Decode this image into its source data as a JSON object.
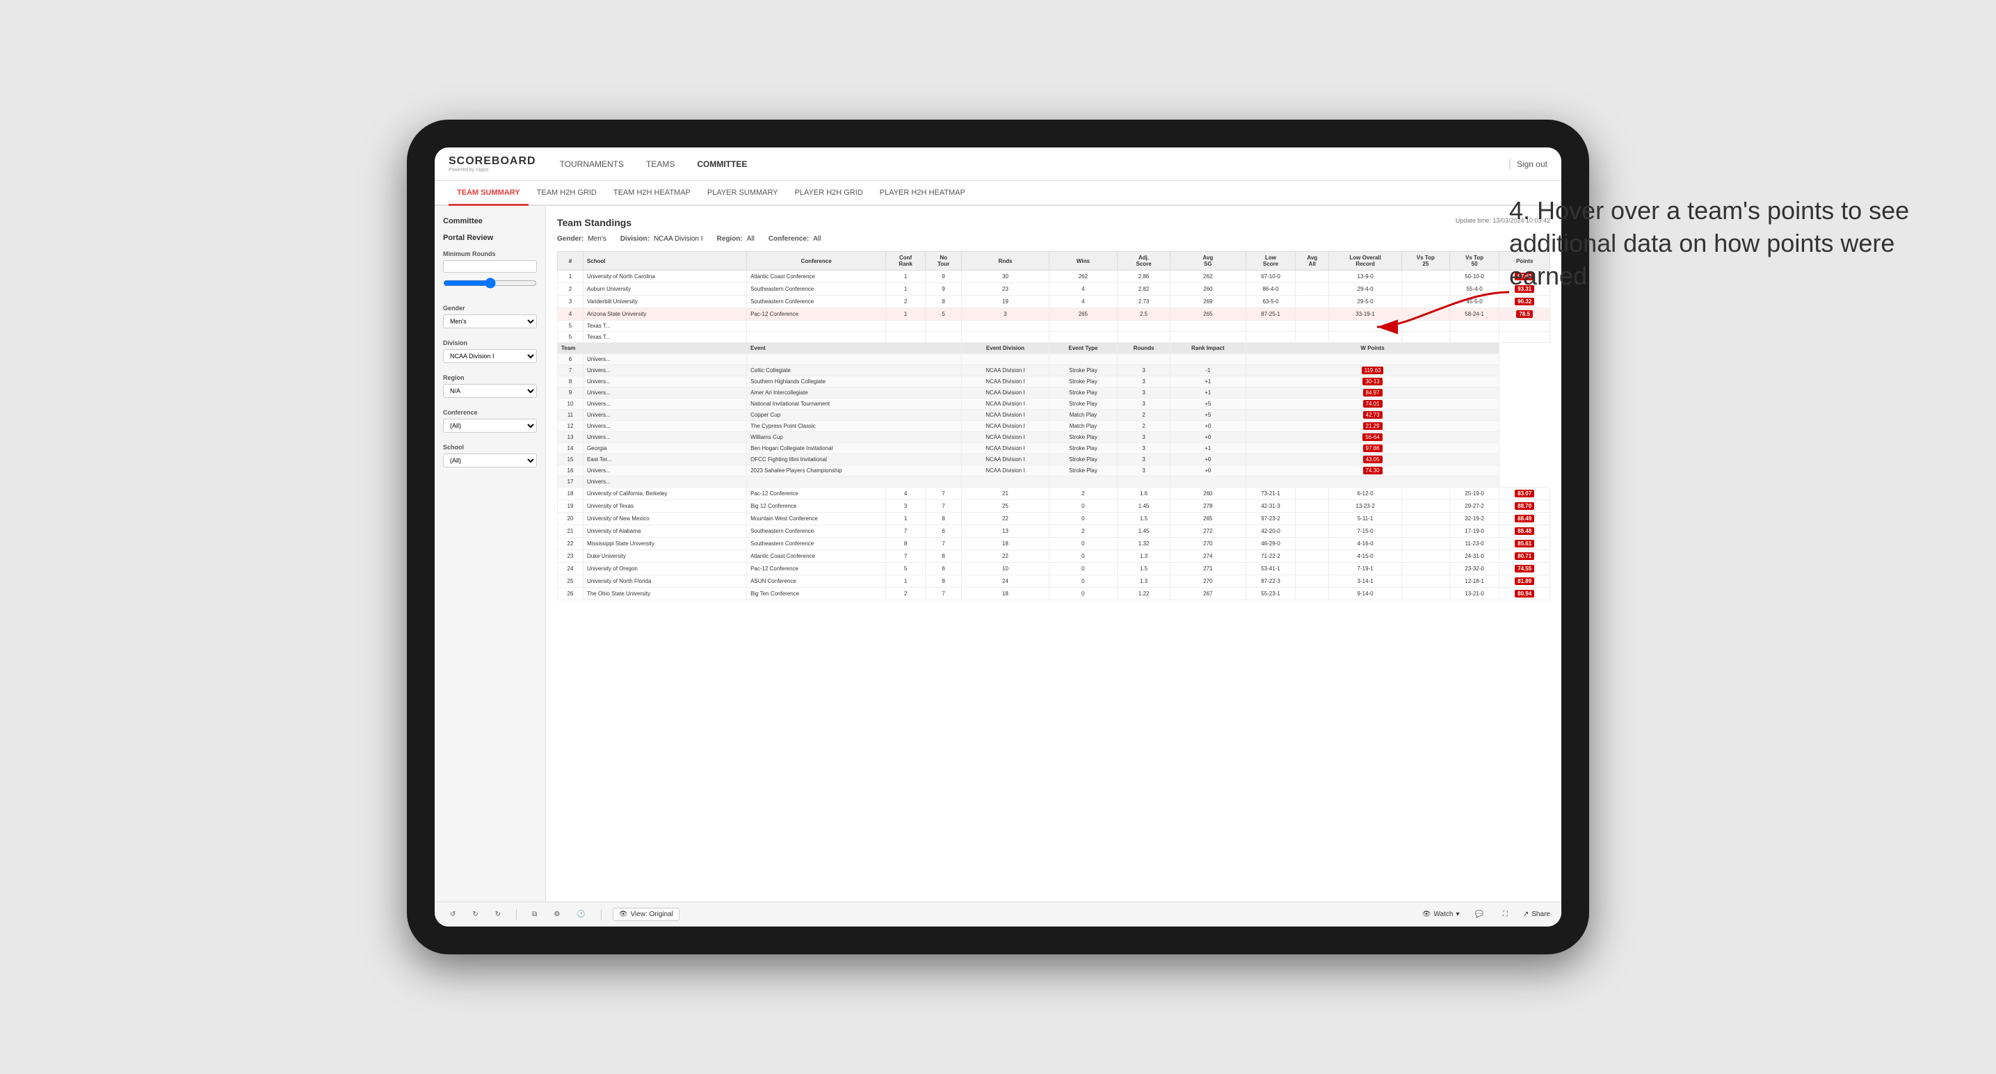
{
  "app": {
    "logo": "SCOREBOARD",
    "logo_sub": "Powered by clippd",
    "sign_out": "Sign out"
  },
  "nav": {
    "items": [
      {
        "label": "TOURNAMENTS",
        "active": false
      },
      {
        "label": "TEAMS",
        "active": false
      },
      {
        "label": "COMMITTEE",
        "active": true
      }
    ]
  },
  "sub_nav": {
    "items": [
      {
        "label": "TEAM SUMMARY",
        "active": true
      },
      {
        "label": "TEAM H2H GRID",
        "active": false
      },
      {
        "label": "TEAM H2H HEATMAP",
        "active": false
      },
      {
        "label": "PLAYER SUMMARY",
        "active": false
      },
      {
        "label": "PLAYER H2H GRID",
        "active": false
      },
      {
        "label": "PLAYER H2H HEATMAP",
        "active": false
      }
    ]
  },
  "sidebar": {
    "title_line1": "Committee",
    "title_line2": "Portal Review",
    "sections": [
      {
        "label": "Minimum Rounds",
        "type": "input",
        "value": ""
      },
      {
        "label": "Gender",
        "type": "select",
        "value": "Men's"
      },
      {
        "label": "Division",
        "type": "select",
        "value": "NCAA Division I"
      },
      {
        "label": "Region",
        "type": "select",
        "value": "N/A"
      },
      {
        "label": "Conference",
        "type": "select",
        "value": "(All)"
      },
      {
        "label": "School",
        "type": "select",
        "value": "(All)"
      }
    ]
  },
  "main": {
    "section_title": "Team Standings",
    "update_time": "Update time: 13/03/2024 10:03:42",
    "filters": {
      "gender_label": "Gender:",
      "gender_value": "Men's",
      "division_label": "Division:",
      "division_value": "NCAA Division I",
      "region_label": "Region:",
      "region_value": "All",
      "conference_label": "Conference:",
      "conference_value": "All"
    },
    "table_headers": [
      "#",
      "School",
      "Conference",
      "Conf Rank",
      "No Tour",
      "Rnds",
      "Wins",
      "Adj Score",
      "Avg SG",
      "Low Score",
      "Avg All",
      "Low Overall Record",
      "Vs Top 25",
      "Vs Top 50",
      "Points"
    ],
    "rows": [
      {
        "rank": 1,
        "school": "University of North Carolina",
        "conference": "Atlantic Coast Conference",
        "conf_rank": 1,
        "no_tour": 9,
        "rnds": 30,
        "wins": 262,
        "adj_score": 2.86,
        "avg_sg": 262,
        "low_score": "67-10-0",
        "low_overall": "13-9-0",
        "vs_top25": "50-10-0",
        "points": "97.02",
        "highlight": false
      },
      {
        "rank": 2,
        "school": "Auburn University",
        "conference": "Southeastern Conference",
        "conf_rank": 1,
        "no_tour": 9,
        "rnds": 23,
        "wins": 4,
        "adj_score": 2.82,
        "avg_sg": 260,
        "low_score": "86-4-0",
        "low_overall": "29-4-0",
        "vs_top25": "55-4-0",
        "points": "93.31",
        "highlight": false
      },
      {
        "rank": 3,
        "school": "Vanderbilt University",
        "conference": "Southeastern Conference",
        "conf_rank": 2,
        "no_tour": 8,
        "rnds": 19,
        "wins": 4,
        "adj_score": 2.73,
        "avg_sg": 269,
        "low_score": "63-5-0",
        "low_overall": "29-5-0",
        "vs_top25": "45-5-0",
        "points": "90.32",
        "highlight": false
      },
      {
        "rank": 4,
        "school": "Arizona State University",
        "conference": "Pac-12 Conference",
        "conf_rank": 1,
        "no_tour": 5,
        "rnds": 3,
        "wins": 265,
        "adj_score": 2.5,
        "avg_sg": 265,
        "low_score": "87-25-1",
        "low_overall": "33-19-1",
        "vs_top25": "58-24-1",
        "points": "78.5",
        "highlight": true
      },
      {
        "rank": 5,
        "school": "Texas T...",
        "conference": "",
        "conf_rank": "",
        "no_tour": "",
        "rnds": "",
        "wins": "",
        "adj_score": "",
        "avg_sg": "",
        "low_score": "",
        "low_overall": "",
        "vs_top25": "",
        "points": "",
        "highlight": false
      }
    ],
    "tooltip_headers": [
      "#",
      "Team",
      "Event",
      "Event Division",
      "Event Type",
      "Rounds",
      "Rank Impact",
      "W Points"
    ],
    "tooltip_rows": [
      {
        "rank": 6,
        "team": "Univers...",
        "event": "",
        "division": "",
        "type": "",
        "rounds": "",
        "rank_impact": "",
        "points": ""
      },
      {
        "rank": 7,
        "team": "Univers...",
        "event": "Celtic Collegiate",
        "division": "NCAA Division I",
        "type": "Stroke Play",
        "rounds": 3,
        "rank_impact": "-1",
        "points": "119.63"
      },
      {
        "rank": 8,
        "team": "Univers...",
        "event": "Southern Highlands Collegiate",
        "division": "NCAA Division I",
        "type": "Stroke Play",
        "rounds": 3,
        "rank_impact": "+1",
        "points": "30-13"
      },
      {
        "rank": 9,
        "team": "Univers...",
        "event": "Amer Ari Intercollegiate",
        "division": "NCAA Division I",
        "type": "Stroke Play",
        "rounds": 3,
        "rank_impact": "+1",
        "points": "84.97"
      },
      {
        "rank": 10,
        "team": "Univers...",
        "event": "National Invitational Tournament",
        "division": "NCAA Division I",
        "type": "Stroke Play",
        "rounds": 3,
        "rank_impact": "+5",
        "points": "74.01"
      },
      {
        "rank": 11,
        "team": "Univers...",
        "event": "Copper Cup",
        "division": "NCAA Division I",
        "type": "Match Play",
        "rounds": 2,
        "rank_impact": "+5",
        "points": "42.73"
      },
      {
        "rank": 12,
        "team": "Univers...",
        "event": "The Cypress Point Classic",
        "division": "NCAA Division I",
        "type": "Match Play",
        "rounds": 2,
        "rank_impact": "+0",
        "points": "21.29"
      },
      {
        "rank": 13,
        "team": "Univers...",
        "event": "Williams Cup",
        "division": "NCAA Division I",
        "type": "Stroke Play",
        "rounds": 3,
        "rank_impact": "+0",
        "points": "56-64"
      },
      {
        "rank": 14,
        "team": "Georgia",
        "event": "Ben Hogan Collegiate Invitational",
        "division": "NCAA Division I",
        "type": "Stroke Play",
        "rounds": 3,
        "rank_impact": "+1",
        "points": "97.86"
      },
      {
        "rank": 15,
        "team": "East Ter...",
        "event": "OFCC Fighting Illini Invitational",
        "division": "NCAA Division I",
        "type": "Stroke Play",
        "rounds": 3,
        "rank_impact": "+0",
        "points": "43.05"
      },
      {
        "rank": 16,
        "team": "Univers...",
        "event": "2023 Sahalee Players Championship",
        "division": "NCAA Division I",
        "type": "Stroke Play",
        "rounds": 3,
        "rank_impact": "+0",
        "points": "74.30"
      },
      {
        "rank": 17,
        "team": "Univers...",
        "event": "",
        "division": "",
        "type": "",
        "rounds": "",
        "rank_impact": "",
        "points": ""
      }
    ],
    "lower_rows": [
      {
        "rank": 18,
        "school": "University of California, Berkeley",
        "conference": "Pac-12 Conference",
        "conf_rank": 4,
        "no_tour": 7,
        "rnds": 21,
        "wins": 2,
        "adj_score": 1.6,
        "avg_sg": 260,
        "low_score": "73-21-1",
        "low_overall": "6-12-0",
        "vs_top25": "25-19-0",
        "points": "83.07"
      },
      {
        "rank": 19,
        "school": "University of Texas",
        "conference": "Big 12 Conference",
        "conf_rank": 3,
        "no_tour": 7,
        "rnds": 25,
        "wins": 0,
        "adj_score": 1.45,
        "avg_sg": 278,
        "low_score": "42-31-3",
        "low_overall": "13-23-2",
        "vs_top25": "29-27-2",
        "points": "88.70"
      },
      {
        "rank": 20,
        "school": "University of New Mexico",
        "conference": "Mountain West Conference",
        "conf_rank": 1,
        "no_tour": 8,
        "rnds": 22,
        "wins": 0,
        "adj_score": 1.5,
        "avg_sg": 265,
        "low_score": "97-23-2",
        "low_overall": "5-11-1",
        "vs_top25": "32-19-2",
        "points": "88.49"
      },
      {
        "rank": 21,
        "school": "University of Alabama",
        "conference": "Southeastern Conference",
        "conf_rank": 7,
        "no_tour": 6,
        "rnds": 13,
        "wins": 2,
        "adj_score": 1.45,
        "avg_sg": 272,
        "low_score": "42-20-0",
        "low_overall": "7-15-0",
        "vs_top25": "17-19-0",
        "points": "88.48"
      },
      {
        "rank": 22,
        "school": "Mississippi State University",
        "conference": "Southeastern Conference",
        "conf_rank": 8,
        "no_tour": 7,
        "rnds": 18,
        "wins": 0,
        "adj_score": 1.32,
        "avg_sg": 270,
        "low_score": "46-29-0",
        "low_overall": "4-16-0",
        "vs_top25": "11-23-0",
        "points": "85.61"
      },
      {
        "rank": 23,
        "school": "Duke University",
        "conference": "Atlantic Coast Conference",
        "conf_rank": 7,
        "no_tour": 8,
        "rnds": 22,
        "wins": 0,
        "adj_score": 1.3,
        "avg_sg": 274,
        "low_score": "71-22-2",
        "low_overall": "4-15-0",
        "vs_top25": "24-31-0",
        "points": "80.71"
      },
      {
        "rank": 24,
        "school": "University of Oregon",
        "conference": "Pac-12 Conference",
        "conf_rank": 5,
        "no_tour": 6,
        "rnds": 10,
        "wins": 0,
        "adj_score": 1.5,
        "avg_sg": 271,
        "low_score": "53-41-1",
        "low_overall": "7-19-1",
        "vs_top25": "23-32-0",
        "points": "74.55"
      },
      {
        "rank": 25,
        "school": "University of North Florida",
        "conference": "ASUN Conference",
        "conf_rank": 1,
        "no_tour": 8,
        "rnds": 24,
        "wins": 0,
        "adj_score": 1.3,
        "avg_sg": 270,
        "low_score": "87-22-3",
        "low_overall": "3-14-1",
        "vs_top25": "12-18-1",
        "points": "81.89"
      },
      {
        "rank": 26,
        "school": "The Ohio State University",
        "conference": "Big Ten Conference",
        "conf_rank": 2,
        "no_tour": 7,
        "rnds": 18,
        "wins": 0,
        "adj_score": 1.22,
        "avg_sg": 267,
        "low_score": "55-23-1",
        "low_overall": "9-14-0",
        "vs_top25": "13-21-0",
        "points": "80.94"
      }
    ],
    "toolbar": {
      "view_label": "View: Original",
      "watch_label": "Watch",
      "share_label": "Share"
    }
  },
  "annotation": {
    "text": "4. Hover over a team's points to see additional data on how points were earned"
  }
}
